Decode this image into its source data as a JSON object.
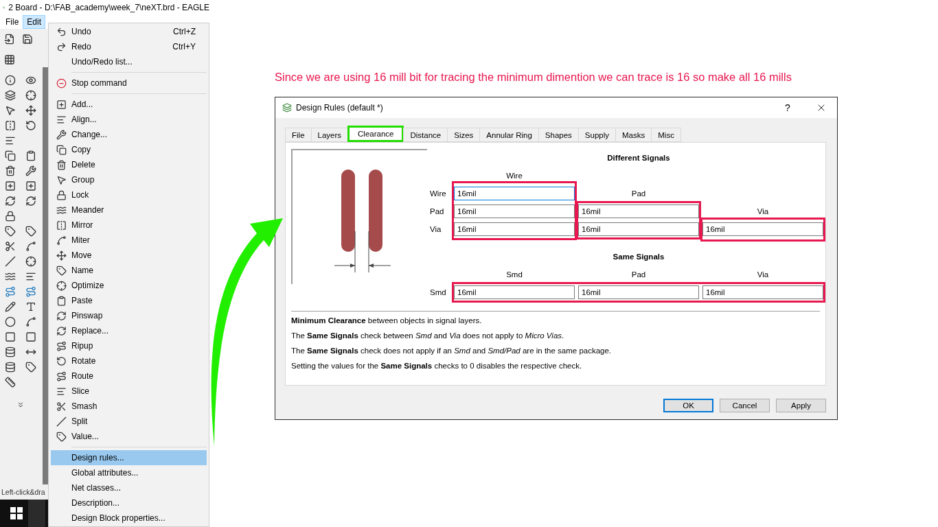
{
  "window": {
    "title": "2 Board - D:\\FAB_academy\\week_7\\neXT.brd - EAGLE"
  },
  "menubar": [
    {
      "label": "File",
      "selected": false
    },
    {
      "label": "Edit",
      "selected": true
    }
  ],
  "edit_menu": [
    {
      "kind": "item",
      "label": "Undo",
      "shortcut": "Ctrl+Z",
      "selected": false
    },
    {
      "kind": "item",
      "label": "Redo",
      "shortcut": "Ctrl+Y",
      "selected": false
    },
    {
      "kind": "item",
      "label": "Undo/Redo list...",
      "selected": false
    },
    {
      "kind": "separator"
    },
    {
      "kind": "item",
      "label": "Stop command",
      "selected": false
    },
    {
      "kind": "separator"
    },
    {
      "kind": "item",
      "label": "Add...",
      "selected": false
    },
    {
      "kind": "item",
      "label": "Align...",
      "selected": false
    },
    {
      "kind": "item",
      "label": "Change...",
      "selected": false
    },
    {
      "kind": "item",
      "label": "Copy",
      "selected": false
    },
    {
      "kind": "item",
      "label": "Delete",
      "selected": false
    },
    {
      "kind": "item",
      "label": "Group",
      "selected": false
    },
    {
      "kind": "item",
      "label": "Lock",
      "selected": false
    },
    {
      "kind": "item",
      "label": "Meander",
      "selected": false
    },
    {
      "kind": "item",
      "label": "Mirror",
      "selected": false
    },
    {
      "kind": "item",
      "label": "Miter",
      "selected": false
    },
    {
      "kind": "item",
      "label": "Move",
      "selected": false
    },
    {
      "kind": "item",
      "label": "Name",
      "selected": false
    },
    {
      "kind": "item",
      "label": "Optimize",
      "selected": false
    },
    {
      "kind": "item",
      "label": "Paste",
      "selected": false
    },
    {
      "kind": "item",
      "label": "Pinswap",
      "selected": false
    },
    {
      "kind": "item",
      "label": "Replace...",
      "selected": false
    },
    {
      "kind": "item",
      "label": "Ripup",
      "selected": false
    },
    {
      "kind": "item",
      "label": "Rotate",
      "selected": false
    },
    {
      "kind": "item",
      "label": "Route",
      "selected": false
    },
    {
      "kind": "item",
      "label": "Slice",
      "selected": false
    },
    {
      "kind": "item",
      "label": "Smash",
      "selected": false
    },
    {
      "kind": "item",
      "label": "Split",
      "selected": false
    },
    {
      "kind": "item",
      "label": "Value...",
      "selected": false
    },
    {
      "kind": "separator"
    },
    {
      "kind": "item",
      "label": "Design rules...",
      "selected": true
    },
    {
      "kind": "item",
      "label": "Global attributes...",
      "selected": false
    },
    {
      "kind": "item",
      "label": "Net classes...",
      "selected": false
    },
    {
      "kind": "item",
      "label": "Description...",
      "selected": false
    },
    {
      "kind": "item",
      "label": "Design Block properties...",
      "selected": false
    }
  ],
  "status_bar": "Left-click&dra",
  "annotation": "Since we are using 16 mill bit for tracing the minimum dimention we can trace is 16 so make all 16 mills",
  "dialog": {
    "title": "Design Rules (default *)",
    "help": "?",
    "tabs": [
      {
        "label": "File",
        "selected": false,
        "highlighted": false
      },
      {
        "label": "Layers",
        "selected": false,
        "highlighted": false
      },
      {
        "label": "Clearance",
        "selected": true,
        "highlighted": true
      },
      {
        "label": "Distance",
        "selected": false,
        "highlighted": false
      },
      {
        "label": "Sizes",
        "selected": false,
        "highlighted": false
      },
      {
        "label": "Annular Ring",
        "selected": false,
        "highlighted": false
      },
      {
        "label": "Shapes",
        "selected": false,
        "highlighted": false
      },
      {
        "label": "Supply",
        "selected": false,
        "highlighted": false
      },
      {
        "label": "Masks",
        "selected": false,
        "highlighted": false
      },
      {
        "label": "Misc",
        "selected": false,
        "highlighted": false
      }
    ],
    "different_signals": {
      "title": "Different Signals",
      "row_labels": [
        "Wire",
        "Pad",
        "Via"
      ],
      "columns": [
        {
          "label": "Wire",
          "highlighted": true,
          "fields": [
            {
              "value": "16mil",
              "focused": true
            },
            {
              "value": "16mil",
              "focused": false
            },
            {
              "value": "16mil",
              "focused": false
            }
          ]
        },
        {
          "label": "Pad",
          "highlighted": true,
          "fields": [
            {
              "value": "16mil",
              "focused": false
            },
            {
              "value": "16mil",
              "focused": false
            }
          ]
        },
        {
          "label": "Via",
          "highlighted": true,
          "fields": [
            {
              "value": "16mil",
              "focused": false
            }
          ]
        }
      ]
    },
    "same_signals": {
      "title": "Same Signals",
      "columns": [
        "Smd",
        "Pad",
        "Via"
      ],
      "rows": [
        {
          "label": "Smd",
          "highlighted": true,
          "fields": [
            {
              "value": "16mil",
              "focused": false
            },
            {
              "value": "16mil",
              "focused": false
            },
            {
              "value": "16mil",
              "focused": false
            }
          ]
        }
      ]
    },
    "notes": [
      "**Minimum Clearance** between objects in signal layers.",
      "The **Same Signals** check between *Smd* and *Via* does not apply to *Micro Vias*.",
      "The **Same Signals** check does not apply if an *Smd* and *Smd/Pad* are in the same package.",
      "Setting the values for the **Same Signals** checks to 0 disables the respective check."
    ],
    "buttons": [
      {
        "label": "OK",
        "default": true
      },
      {
        "label": "Cancel",
        "default": false
      },
      {
        "label": "Apply",
        "default": false
      }
    ]
  }
}
